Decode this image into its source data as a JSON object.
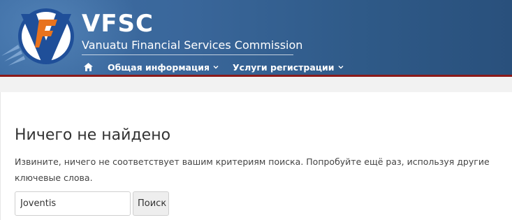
{
  "header": {
    "brand_title": "VFSC",
    "brand_subtitle": "Vanuatu Financial Services Commission",
    "logo_icon": "vfsc-logo-icon",
    "colors": {
      "header_blue": "#3a679b",
      "accent_red": "#8b1a1a",
      "logo_orange": "#e8731e"
    }
  },
  "nav": {
    "home_icon": "home-icon",
    "items": [
      {
        "label": "Общая информация",
        "icon": "chevron-down-icon"
      },
      {
        "label": "Услуги регистрации",
        "icon": "chevron-down-icon"
      }
    ]
  },
  "main": {
    "title": "Ничего не найдено",
    "message": "Извините, ничего не соответствует вашим критериям поиска. Попробуйте ещё раз, используя другие ключевые слова.",
    "search": {
      "value": "Joventis",
      "button_label": "Поиск"
    }
  }
}
